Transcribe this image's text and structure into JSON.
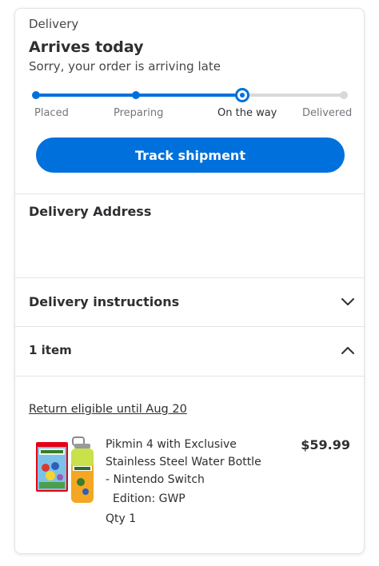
{
  "delivery": {
    "section_label": "Delivery",
    "status_title": "Arrives today",
    "status_message": "Sorry, your order is arriving late",
    "progress": {
      "steps": [
        "Placed",
        "Preparing",
        "On the way",
        "Delivered"
      ],
      "current_step": "On the way"
    },
    "track_button_label": "Track shipment"
  },
  "address": {
    "title": "Delivery Address"
  },
  "instructions": {
    "title": "Delivery instructions",
    "expanded": false
  },
  "items": {
    "title": "1 item",
    "expanded": true,
    "return_text": "Return eligible until Aug 20",
    "list": [
      {
        "name": "Pikmin 4 with Exclusive Stainless Steel Water Bottle - Nintendo Switch",
        "edition": "Edition: GWP",
        "quantity": "Qty 1",
        "price": "$59.99"
      }
    ]
  },
  "colors": {
    "accent": "#0071dc",
    "track_inactive": "#d8d9da",
    "text_primary": "#2e2f32"
  }
}
